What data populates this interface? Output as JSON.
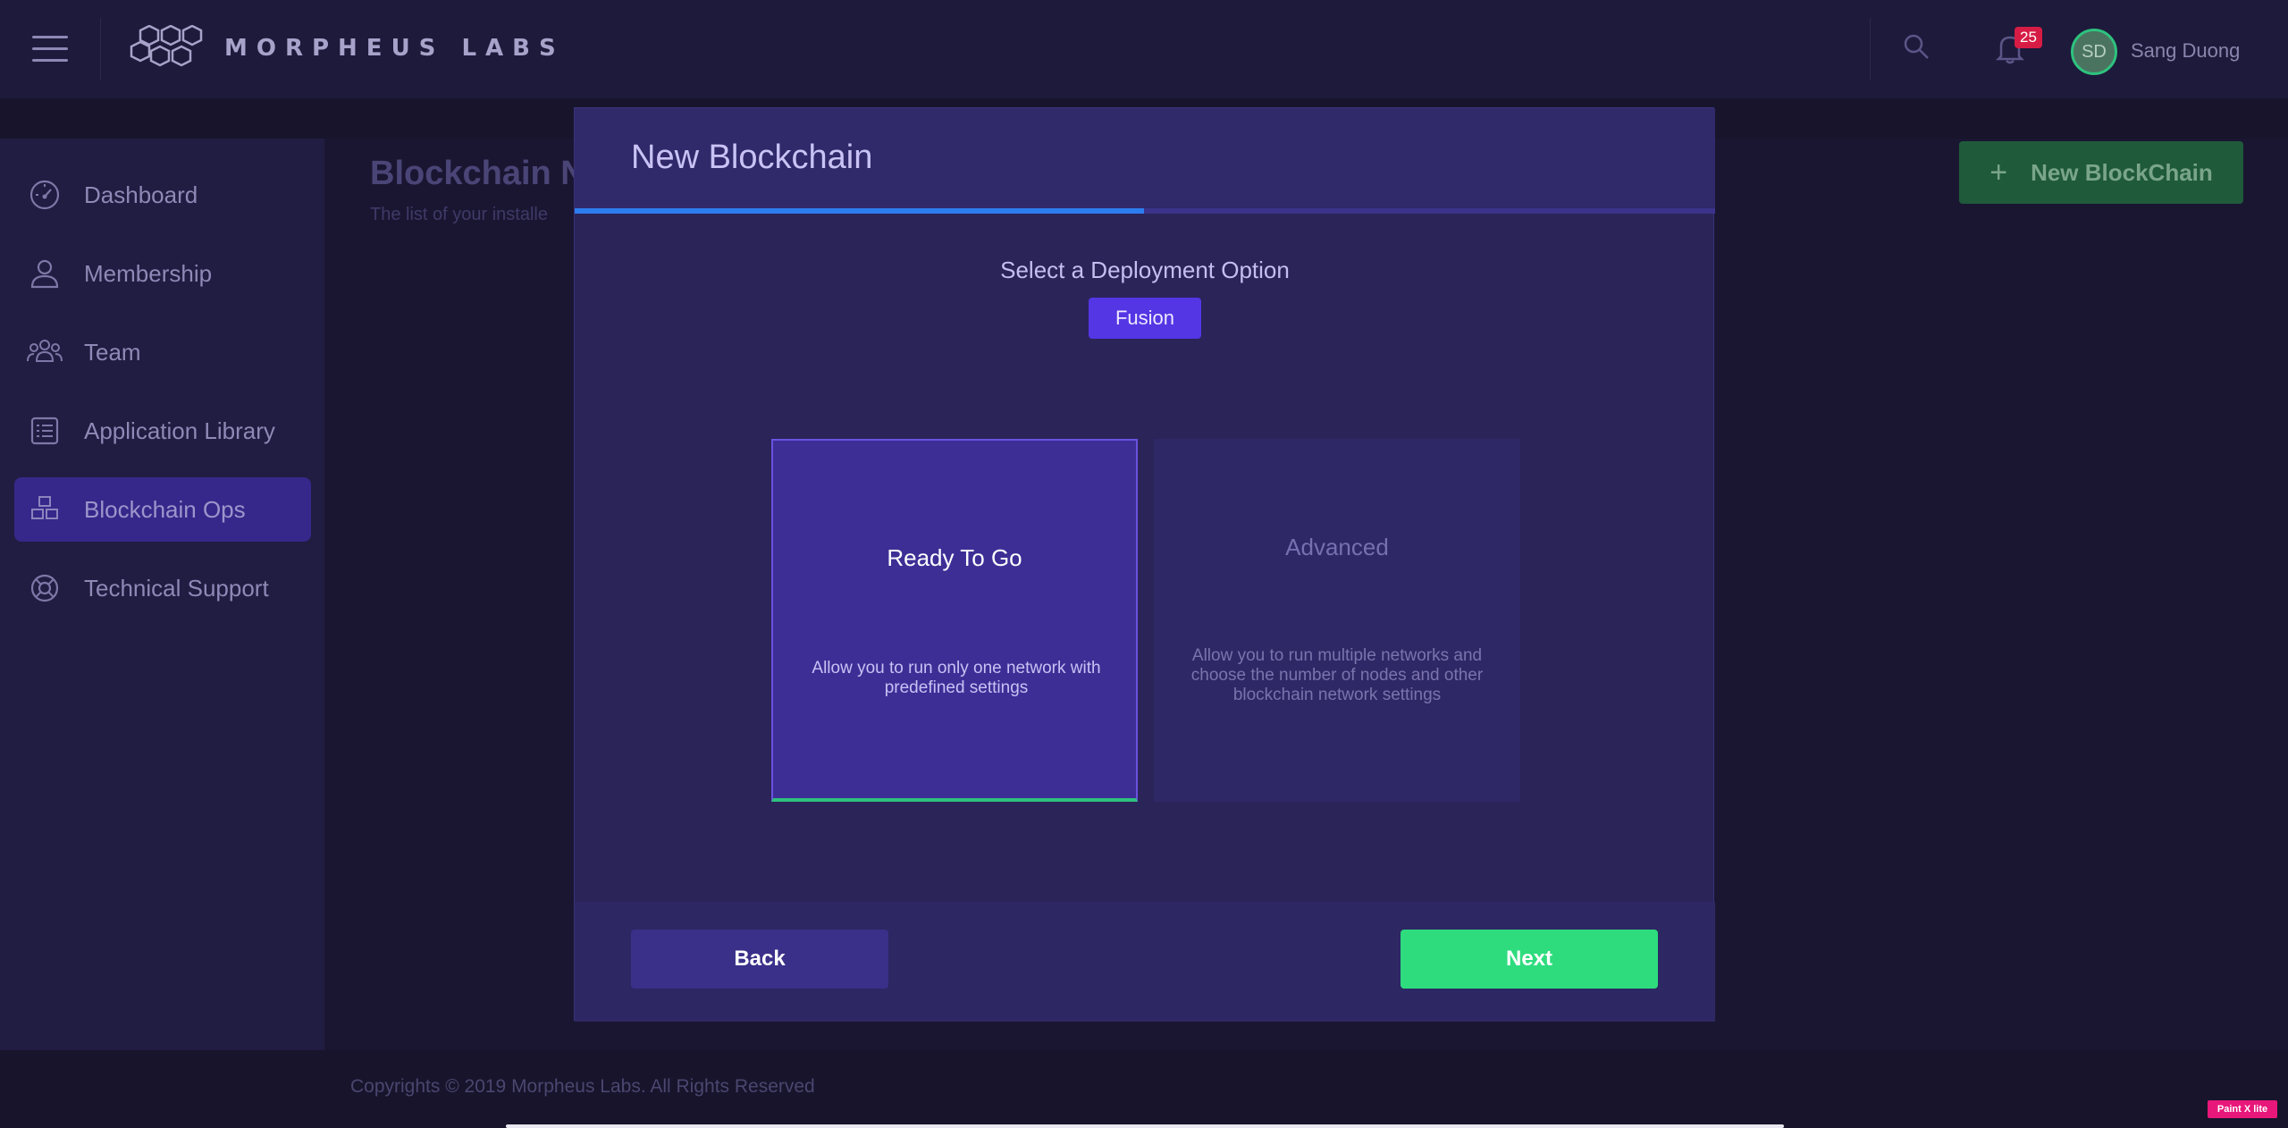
{
  "app": {
    "logo_text": "MORPHEUS LABS",
    "notification_count": "25",
    "user_initials": "SD",
    "user_name": "Sang Duong"
  },
  "sidebar": {
    "items": [
      {
        "label": "Dashboard",
        "icon": "speedometer-icon"
      },
      {
        "label": "Membership",
        "icon": "user-icon"
      },
      {
        "label": "Team",
        "icon": "team-icon"
      },
      {
        "label": "Application Library",
        "icon": "list-icon"
      },
      {
        "label": "Blockchain Ops",
        "icon": "cubes-icon",
        "active": true
      },
      {
        "label": "Technical Support",
        "icon": "lifebuoy-icon"
      }
    ]
  },
  "page": {
    "title": "Blockchain N",
    "subtitle": "The list of your installe",
    "new_button_label": "New BlockChain",
    "new_button_icon": "+"
  },
  "modal": {
    "title": "New Blockchain",
    "progress": 0.5,
    "select_label": "Select a Deployment Option",
    "platform_tag": "Fusion",
    "options": [
      {
        "title": "Ready To Go",
        "description": "Allow you to run only one network with predefined settings",
        "selected": true
      },
      {
        "title": "Advanced",
        "description": "Allow you to run multiple networks and choose the number of nodes and other blockchain network settings",
        "selected": false
      }
    ],
    "back_label": "Back",
    "next_label": "Next"
  },
  "footer": {
    "copyright": "Copyrights © 2019 Morpheus Labs. All Rights Reserved"
  },
  "overlay_badge": "Paint X lite",
  "colors": {
    "accent": "#5436e4",
    "success": "#2edc7e",
    "progress": "#2d7cf0",
    "badge": "#d61c44"
  }
}
